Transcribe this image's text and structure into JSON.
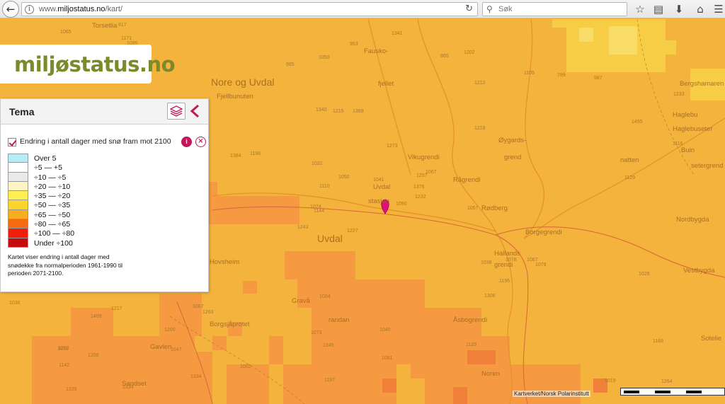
{
  "browser": {
    "url_prefix": "www.",
    "url_domain": "miljostatus.no",
    "url_path": "/kart/",
    "search_placeholder": "Søk",
    "icons": [
      "back-arrow-icon",
      "info-icon",
      "reload-icon",
      "search-icon",
      "bookmark-star-icon",
      "reading-list-icon",
      "download-icon",
      "home-icon"
    ]
  },
  "logo": {
    "text": "miljøstatus.no"
  },
  "panel": {
    "title": "Tema",
    "layer_name": "Endring i antall dager med snø fram mot 2100",
    "layer_checked": true,
    "description": "Kartet viser endring i antall dager med snødekke fra normalperioden 1961-1990 til perioden 2071-2100.",
    "legend": [
      {
        "label": "Over 5",
        "color": "#b7ecf7"
      },
      {
        "label": "÷5 — +5",
        "color": "#ffffff"
      },
      {
        "label": "÷10 — ÷5",
        "color": "#e9e9e9"
      },
      {
        "label": "÷20 — ÷10",
        "color": "#fff5c2"
      },
      {
        "label": "÷35 — ÷20",
        "color": "#ffef52"
      },
      {
        "label": "÷50 — ÷35",
        "color": "#fcd52c"
      },
      {
        "label": "÷65 — ÷50",
        "color": "#f8ac1f"
      },
      {
        "label": "÷80 — ÷65",
        "color": "#f56b12"
      },
      {
        "label": "÷100 — ÷80",
        "color": "#f01e0a"
      },
      {
        "label": "Under ÷100",
        "color": "#c50b0b"
      }
    ]
  },
  "map": {
    "attribution": "Kartverket/Norsk Polarinstitutt",
    "place_labels": [
      {
        "text": "Torsetlia"
      },
      {
        "text": "Nore og Uvdal"
      },
      {
        "text": "Fjellbunuten"
      },
      {
        "text": "Fausko-"
      },
      {
        "text": "fjellet"
      },
      {
        "text": "Vikugrendi"
      },
      {
        "text": "Uvdal"
      },
      {
        "text": "stasjon"
      },
      {
        "text": "Øygards-"
      },
      {
        "text": "grend"
      },
      {
        "text": "Rågrendi"
      },
      {
        "text": "Rødberg"
      },
      {
        "text": "Borgegrendi"
      },
      {
        "text": "Hallands"
      },
      {
        "text": "grendi"
      },
      {
        "text": "Bergshamaren"
      },
      {
        "text": "Haglebu"
      },
      {
        "text": "Haglebuseter"
      },
      {
        "text": "Buin"
      },
      {
        "text": "natten"
      },
      {
        "text": "setergrend"
      },
      {
        "text": "Nordbygda"
      },
      {
        "text": "Vestbygda"
      },
      {
        "text": "Sotelie"
      },
      {
        "text": "Uvdal"
      },
      {
        "text": "Gravå"
      },
      {
        "text": "Borgsjåprotet"
      },
      {
        "text": "Gavlen"
      },
      {
        "text": "Sandset"
      },
      {
        "text": "Åsbogrendi"
      },
      {
        "text": "Noren"
      },
      {
        "text": "randan"
      },
      {
        "text": "Hovsheim"
      }
    ],
    "spot_heights": [
      "1227",
      "1176",
      "1144",
      "1262",
      "1257",
      "1263",
      "1202",
      "1369",
      "1212",
      "1090",
      "1095",
      "1264",
      "1281",
      "1233",
      "1243",
      "1218",
      "1334",
      "1340",
      "1273",
      "1217",
      "1198",
      "1142",
      "1047",
      "1215",
      "1067",
      "1079",
      "1023",
      "1050",
      "1202",
      "1038",
      "1116",
      "1074",
      "1073",
      "1110",
      "1052",
      "1105",
      "1067",
      "1019",
      "1168",
      "1067",
      "1341",
      "1384",
      "1396",
      "1306",
      "1334",
      "1361",
      "1376",
      "1339",
      "1345",
      "1232",
      "1409",
      "1495",
      "1350",
      "1196",
      "1129",
      "1200",
      "1171",
      "1065",
      "1040",
      "987",
      "953",
      "931",
      "941",
      "1009",
      "789",
      "917",
      "865",
      "985",
      "1050",
      "1036",
      "1004",
      "1002",
      "1078",
      "914",
      "1010",
      "1005",
      "1036",
      "1024",
      "1032",
      "1081",
      "1041",
      "1208",
      "1057",
      "1028",
      "1197",
      "1129"
    ]
  }
}
